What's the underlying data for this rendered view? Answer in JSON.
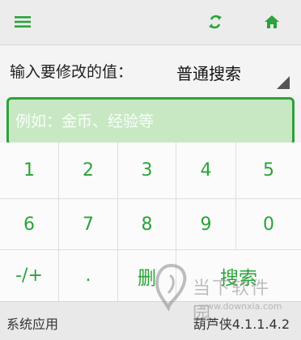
{
  "toolbar": {
    "menu_icon": "menu-icon",
    "refresh_icon": "refresh-icon",
    "home_icon": "home-icon"
  },
  "search": {
    "label": "输入要修改的值：",
    "mode": "普通搜索",
    "placeholder": "例如：金币、经验等",
    "value": ""
  },
  "keypad": {
    "row1": [
      "1",
      "2",
      "3",
      "4",
      "5"
    ],
    "row2": [
      "6",
      "7",
      "8",
      "9",
      "0"
    ],
    "row3": {
      "sign": "-/+",
      "dot": ".",
      "delete": "删",
      "search": "搜索"
    }
  },
  "footer": {
    "left": "系统应用",
    "right": "葫芦侠4.1.1.4.2"
  },
  "watermark": {
    "text": "当下软件园",
    "url": "www.downxia.com"
  },
  "colors": {
    "accent": "#2aa33a",
    "input_bg": "#c8e8c4"
  }
}
